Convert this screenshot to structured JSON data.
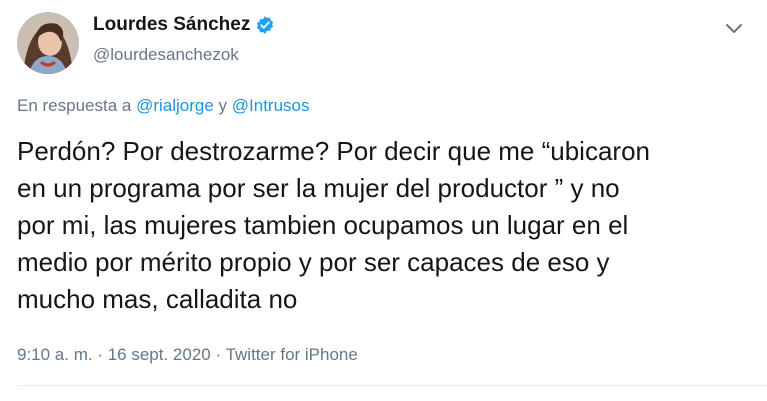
{
  "author": {
    "name": "Lourdes Sánchez",
    "handle": "@lourdesanchezok",
    "verified": true,
    "avatar_icon": "profile-photo",
    "verified_icon": "verified-badge-icon",
    "verified_color": "#1da1f2"
  },
  "reply": {
    "prefix": "En respuesta a ",
    "mention_1": "@rialjorge",
    "joiner": " y ",
    "mention_2": "@Intrusos"
  },
  "tweet": {
    "text": "Perdón? Por destrozarme? Por decir que me “ubicaron\nen un programa por ser la mujer del productor ” y no\npor mi, las mujeres tambien ocupamos un lugar en el\nmedio por mérito propio y por ser capaces de eso y\nmucho mas, calladita no"
  },
  "meta": {
    "time": "9:10 a. m.",
    "sep1": " · ",
    "date": "16 sept. 2020",
    "sep2": " · ",
    "source": "Twitter for iPhone"
  },
  "menu_icon": "chevron-down-icon",
  "colors": {
    "text": "#14171a",
    "secondary": "#657786",
    "link": "#1b95e0"
  }
}
